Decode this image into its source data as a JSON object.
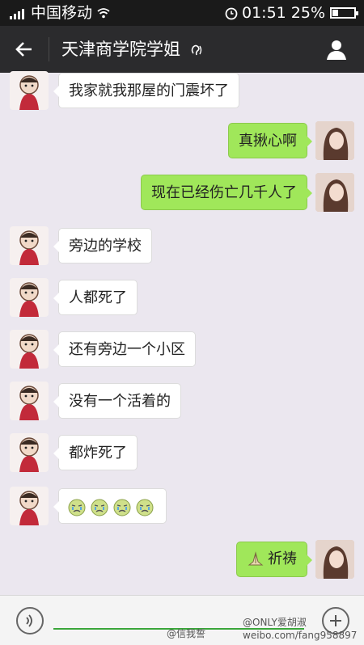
{
  "status_bar": {
    "carrier": "中国移动",
    "time": "01:51",
    "battery": "25%",
    "battery_level": 0.25
  },
  "header": {
    "title": "天津商学院学姐",
    "back_icon": "back-arrow-icon",
    "ear_icon": "earpiece-mode-icon",
    "profile_icon": "person-icon"
  },
  "messages": [
    {
      "side": "left",
      "text": "我家就我那屋的门震坏了"
    },
    {
      "side": "right",
      "text": "真揪心啊"
    },
    {
      "side": "right",
      "text": "现在已经伤亡几千人了"
    },
    {
      "side": "left",
      "text": "旁边的学校"
    },
    {
      "side": "left",
      "text": "人都死了"
    },
    {
      "side": "left",
      "text": "还有旁边一个小区"
    },
    {
      "side": "left",
      "text": "没有一个活着的"
    },
    {
      "side": "left",
      "text": "都炸死了"
    },
    {
      "side": "left",
      "text": "",
      "emoji": "crying-face-x4"
    },
    {
      "side": "right",
      "text": "祈祷",
      "emoji": "praying-hands"
    }
  ],
  "input_bar": {
    "voice_icon": "voice-input-icon",
    "plus_icon": "more-options-icon"
  },
  "watermark": {
    "left": "@信我誓",
    "right_line1": "@ONLY爱胡淑",
    "right_line2": "weibo.com/fang958897"
  },
  "colors": {
    "title_bar": "#2b2b2d",
    "chat_background": "#ebe7ef",
    "bubble_incoming": "#ffffff",
    "bubble_outgoing": "#a0e75a"
  }
}
